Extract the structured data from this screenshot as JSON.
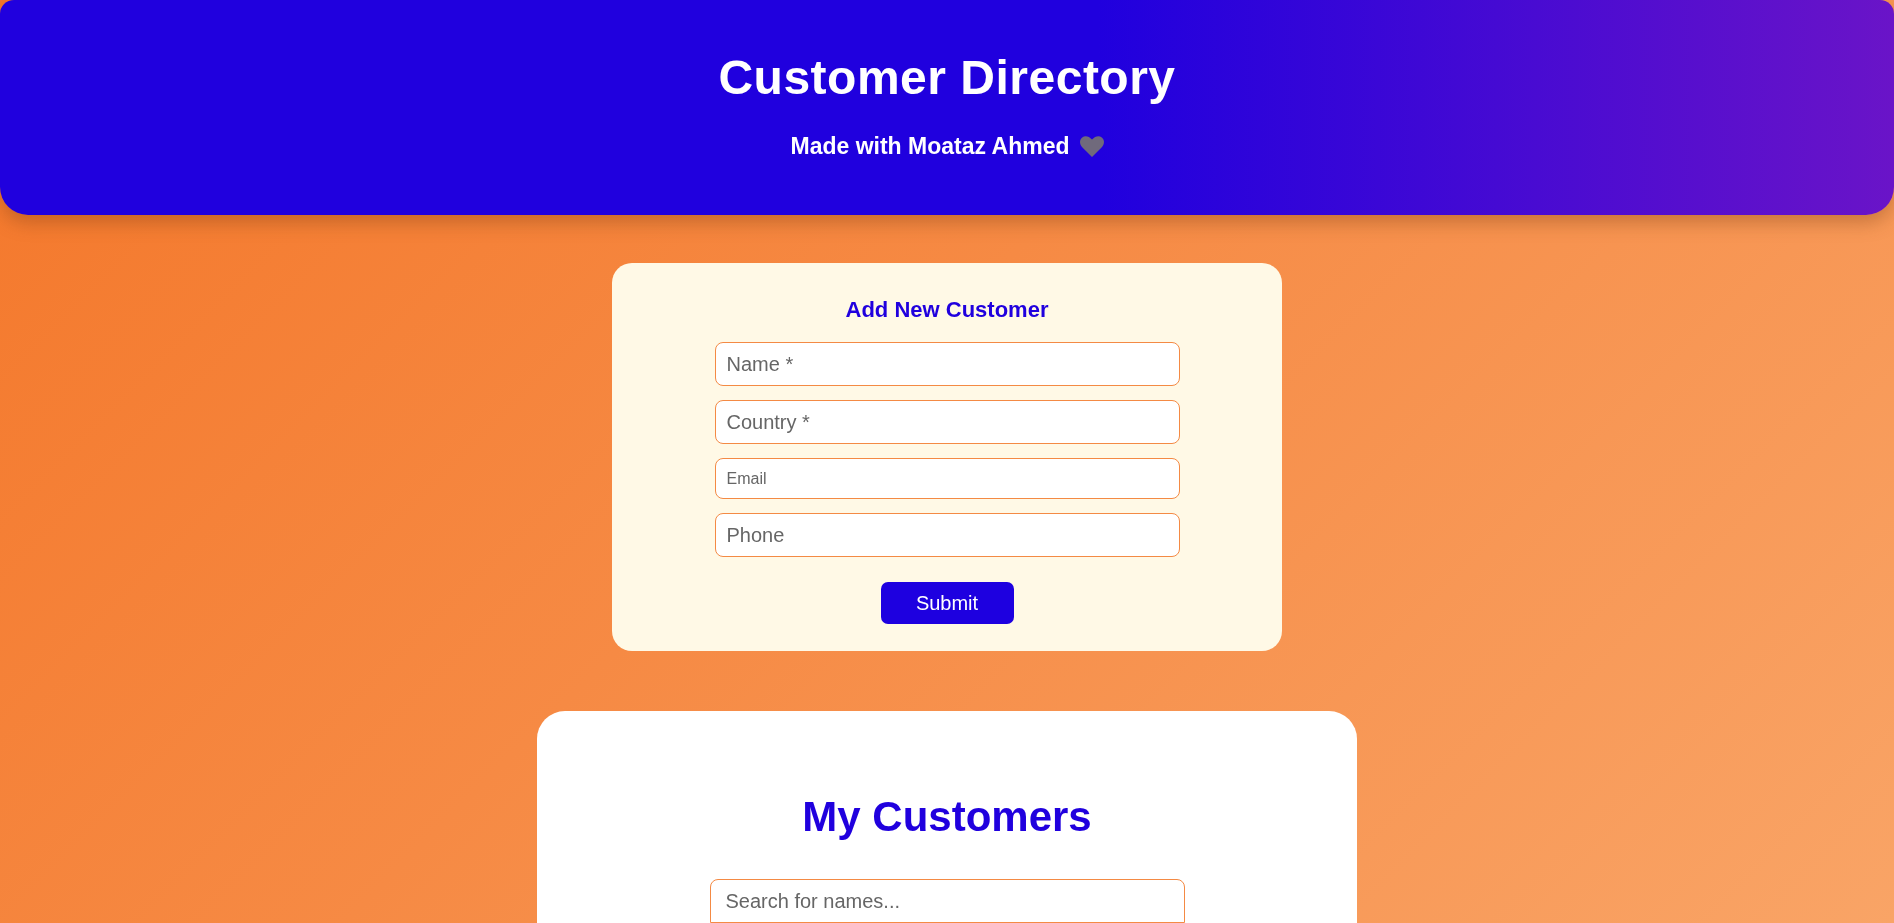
{
  "header": {
    "title": "Customer Directory",
    "subtitle": "Made with Moataz Ahmed"
  },
  "add_customer_form": {
    "title": "Add New Customer",
    "fields": [
      {
        "kind": "text",
        "placeholder": "Name *"
      },
      {
        "kind": "text",
        "placeholder": "Country *"
      },
      {
        "kind": "email",
        "placeholder": "Email"
      },
      {
        "kind": "text",
        "placeholder": "Phone"
      }
    ],
    "submit_button": "Submit"
  },
  "customers_panel": {
    "title": "My Customers",
    "search": {
      "placeholder": "Search for names..."
    }
  }
}
